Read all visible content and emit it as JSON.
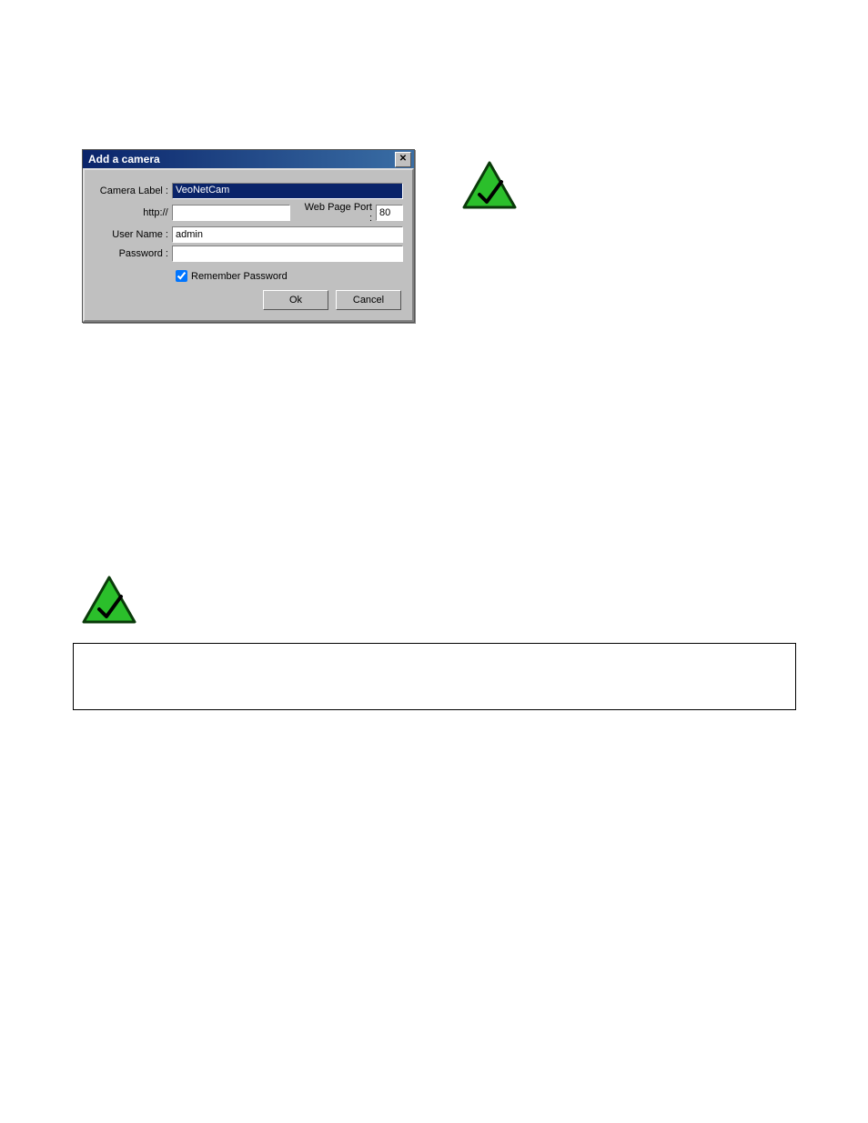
{
  "dialog": {
    "title": "Add a camera",
    "labels": {
      "camera_label": "Camera Label :",
      "http": "http://",
      "port": "Web Page Port :",
      "username": "User Name :",
      "password": "Password :",
      "remember": "Remember Password"
    },
    "values": {
      "camera_label": "VeoNetCam",
      "http": "",
      "port": "80",
      "username": "admin",
      "password": ""
    },
    "buttons": {
      "ok": "Ok",
      "cancel": "Cancel"
    },
    "close_glyph": "✕"
  },
  "icons": {
    "warning_fill": "#2bbf2b",
    "warning_stroke": "#0a3a0a",
    "check_stroke": "#000000"
  }
}
